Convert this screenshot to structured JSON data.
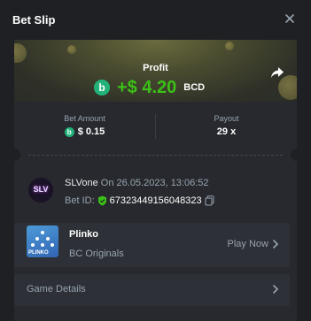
{
  "header": {
    "title": "Bet Slip"
  },
  "hero": {
    "profit_label": "Profit",
    "amount": "+$ 4.20",
    "currency": "BCD"
  },
  "stats": {
    "bet_amount_label": "Bet Amount",
    "bet_amount_value": "$ 0.15",
    "payout_label": "Payout",
    "payout_value": "29 x"
  },
  "user": {
    "avatar_text": "SLV",
    "username": "SLVone",
    "date_text": "On 26.05.2023, 13:06:52",
    "bet_id_label": "Bet ID:",
    "bet_id_value": "67323449156048323"
  },
  "game": {
    "thumb_label": "PLINKO",
    "name": "Plinko",
    "provider": "BC Originals",
    "play_now": "Play Now"
  },
  "details": {
    "label": "Game Details"
  },
  "colors": {
    "accent_green": "#3bc117",
    "coin_green": "#23b37a",
    "muted_text": "#99a4b0",
    "background": "#1e2024"
  },
  "icons": [
    "close-icon",
    "share-icon",
    "coin-icon",
    "shield-icon",
    "copy-icon",
    "chevron-right-icon"
  ]
}
